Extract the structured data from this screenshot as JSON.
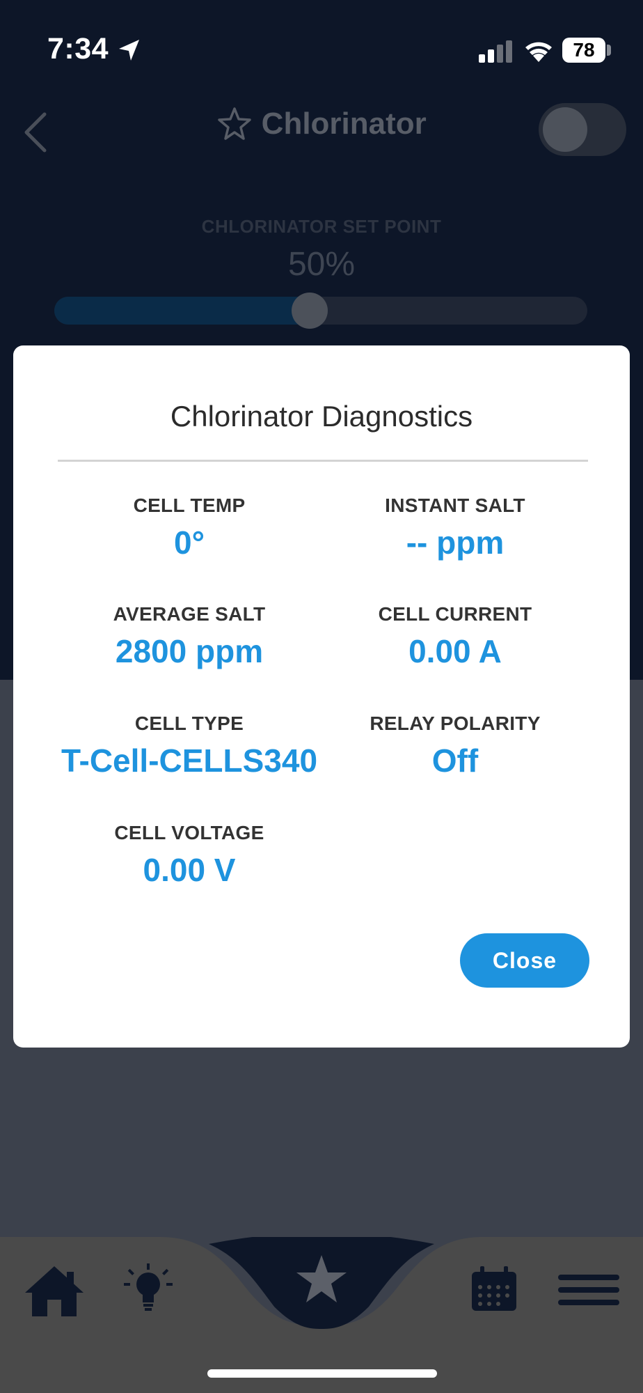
{
  "status_bar": {
    "time": "7:34",
    "battery": "78",
    "icons": [
      "location-arrow-icon",
      "cellular-signal-icon",
      "wifi-icon",
      "battery-icon"
    ]
  },
  "header": {
    "title": "Chlorinator",
    "icons": [
      "back-chevron-icon",
      "star-outline-icon"
    ],
    "toggle_on": false
  },
  "setpoint": {
    "label": "CHLORINATOR SET POINT",
    "value": "50%",
    "fraction": 0.5
  },
  "modal": {
    "title": "Chlorinator Diagnostics",
    "stats": [
      {
        "label": "CELL TEMP",
        "value": "0°"
      },
      {
        "label": "INSTANT SALT",
        "value": "-- ppm"
      },
      {
        "label": "AVERAGE SALT",
        "value": "2800 ppm"
      },
      {
        "label": "CELL CURRENT",
        "value": "0.00 A"
      },
      {
        "label": "CELL TYPE",
        "value": "T-Cell-CELLS340"
      },
      {
        "label": "RELAY POLARITY",
        "value": "Off"
      },
      {
        "label": "CELL VOLTAGE",
        "value": "0.00 V"
      }
    ],
    "close_label": "Close"
  },
  "tabbar": {
    "items": [
      "home-icon",
      "lightbulb-icon",
      "star-icon",
      "calendar-icon",
      "menu-icon"
    ],
    "active": "star-icon"
  },
  "colors": {
    "accent": "#1e93de",
    "navy": "#0d1628",
    "overlay_gray": "#3c414c"
  }
}
